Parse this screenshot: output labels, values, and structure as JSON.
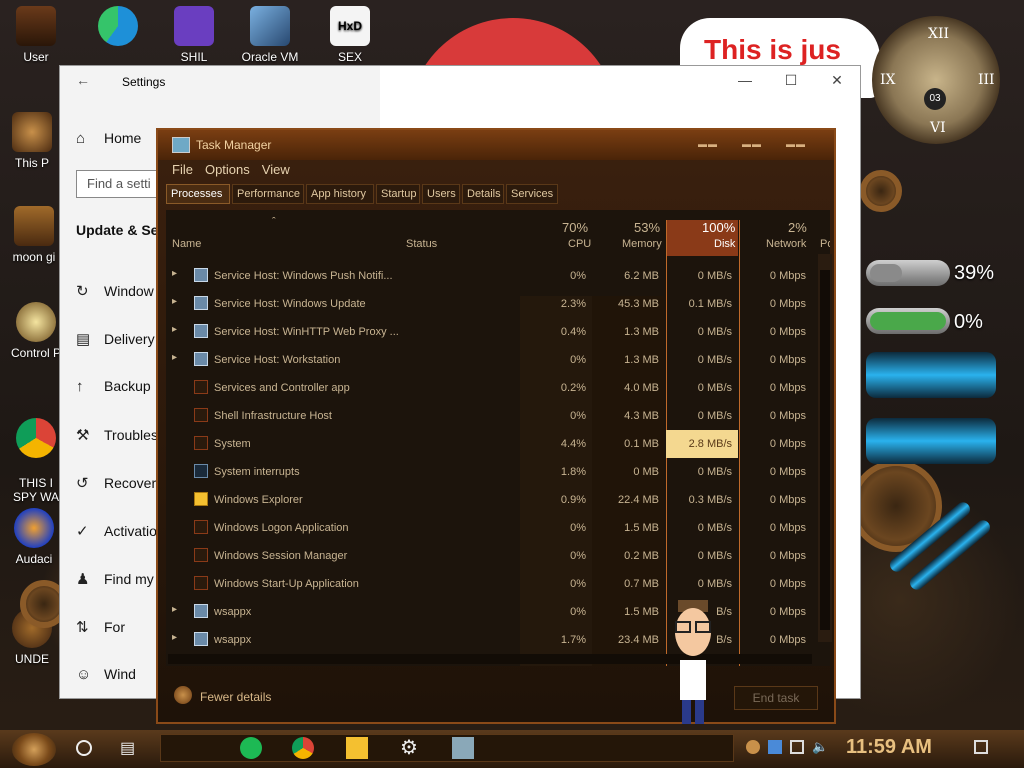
{
  "desktop": {
    "icons": [
      {
        "label": "User",
        "name": "user-folder"
      },
      {
        "label": "This P",
        "name": "this-pc"
      },
      {
        "label": "moon gi",
        "name": "moon-gi"
      },
      {
        "label": "Control P",
        "name": "control-panel"
      },
      {
        "label": "THIS I\nSPY WA",
        "name": "chrome-shortcut"
      },
      {
        "label": "Audaci",
        "name": "audacity"
      },
      {
        "label": "UNDE",
        "name": "unde"
      }
    ],
    "top_icons": [
      {
        "label": "",
        "name": "edge"
      },
      {
        "label": "SHIL",
        "name": "visual-studio"
      },
      {
        "label": "Oracle VM",
        "name": "virtualbox"
      },
      {
        "label": "SEX",
        "name": "hxd"
      }
    ],
    "bubble_text": "This is jus",
    "meters": [
      {
        "value": "39%",
        "fill": 0.39,
        "color": "#8a8a8a"
      },
      {
        "value": "0%",
        "fill": 0.0,
        "color": "#4aa84a"
      }
    ],
    "clock_badge": "03"
  },
  "settings": {
    "title": "Settings",
    "home": "Home",
    "search_placeholder": "Find a setti",
    "heading": "Update & Se",
    "items": [
      {
        "label": "Window",
        "icon": "refresh-icon"
      },
      {
        "label": "Delivery",
        "icon": "delivery-icon"
      },
      {
        "label": "Backup",
        "icon": "backup-icon"
      },
      {
        "label": "Troubles",
        "icon": "wrench-icon"
      },
      {
        "label": "Recover",
        "icon": "recovery-icon"
      },
      {
        "label": "Activatio",
        "icon": "check-circle-icon"
      },
      {
        "label": "Find my",
        "icon": "person-icon"
      },
      {
        "label": "For",
        "icon": "sliders-icon"
      },
      {
        "label": "Wind",
        "icon": "cat-icon"
      }
    ]
  },
  "taskmanager": {
    "title": "Task Manager",
    "menu": [
      "File",
      "Options",
      "View"
    ],
    "tabs": [
      "Processes",
      "Performance",
      "App history",
      "Startup",
      "Users",
      "Details",
      "Services"
    ],
    "columns": {
      "name": "Name",
      "status": "Status",
      "cpu": {
        "pct": "70%",
        "label": "CPU"
      },
      "memory": {
        "pct": "53%",
        "label": "Memory"
      },
      "disk": {
        "pct": "100%",
        "label": "Disk"
      },
      "network": {
        "pct": "2%",
        "label": "Network"
      },
      "power": "Po"
    },
    "rows": [
      {
        "name": "Service Host: Windows Push Notifi...",
        "expand": true,
        "icon": "service-icon",
        "cpu": "0%",
        "mem": "6.2 MB",
        "disk": "0 MB/s",
        "net": "0 Mbps"
      },
      {
        "name": "Service Host: Windows Update",
        "expand": true,
        "icon": "service-icon",
        "cpu": "2.3%",
        "mem": "45.3 MB",
        "disk": "0.1 MB/s",
        "net": "0 Mbps"
      },
      {
        "name": "Service Host: WinHTTP Web Proxy ...",
        "expand": true,
        "icon": "service-icon",
        "cpu": "0.4%",
        "mem": "1.3 MB",
        "disk": "0 MB/s",
        "net": "0 Mbps"
      },
      {
        "name": "Service Host: Workstation",
        "expand": true,
        "icon": "service-icon",
        "cpu": "0%",
        "mem": "1.3 MB",
        "disk": "0 MB/s",
        "net": "0 Mbps"
      },
      {
        "name": "Services and Controller app",
        "expand": false,
        "icon": "app-icon",
        "cpu": "0.2%",
        "mem": "4.0 MB",
        "disk": "0 MB/s",
        "net": "0 Mbps"
      },
      {
        "name": "Shell Infrastructure Host",
        "expand": false,
        "icon": "app-icon",
        "cpu": "0%",
        "mem": "4.3 MB",
        "disk": "0 MB/s",
        "net": "0 Mbps"
      },
      {
        "name": "System",
        "expand": false,
        "icon": "app-icon",
        "cpu": "4.4%",
        "mem": "0.1 MB",
        "disk": "2.8 MB/s",
        "net": "0 Mbps",
        "hot": true
      },
      {
        "name": "System interrupts",
        "expand": false,
        "icon": "window-icon",
        "cpu": "1.8%",
        "mem": "0 MB",
        "disk": "0 MB/s",
        "net": "0 Mbps"
      },
      {
        "name": "Windows Explorer",
        "expand": false,
        "icon": "folder-icon",
        "cpu": "0.9%",
        "mem": "22.4 MB",
        "disk": "0.3 MB/s",
        "net": "0 Mbps"
      },
      {
        "name": "Windows Logon Application",
        "expand": false,
        "icon": "app-icon",
        "cpu": "0%",
        "mem": "1.5 MB",
        "disk": "0 MB/s",
        "net": "0 Mbps"
      },
      {
        "name": "Windows Session Manager",
        "expand": false,
        "icon": "app-icon",
        "cpu": "0%",
        "mem": "0.2 MB",
        "disk": "0 MB/s",
        "net": "0 Mbps"
      },
      {
        "name": "Windows Start-Up Application",
        "expand": false,
        "icon": "app-icon",
        "cpu": "0%",
        "mem": "0.7 MB",
        "disk": "0 MB/s",
        "net": "0 Mbps"
      },
      {
        "name": "wsappx",
        "expand": true,
        "icon": "service-icon",
        "cpu": "0%",
        "mem": "1.5 MB",
        "disk": "B/s",
        "net": "0 Mbps"
      },
      {
        "name": "wsappx",
        "expand": true,
        "icon": "service-icon",
        "cpu": "1.7%",
        "mem": "23.4 MB",
        "disk": "B/s",
        "net": "0 Mbps"
      }
    ],
    "fewer_details": "Fewer details",
    "end_task": "End task"
  },
  "taskbar": {
    "time": "11:59 AM",
    "apps": [
      "spotify-icon",
      "chrome-icon",
      "file-explorer-icon",
      "settings-gear-icon",
      "task-manager-icon"
    ]
  },
  "colors": {
    "disk_hot": "#f4d890",
    "disk_header": "#8a3a18",
    "text": "#c8b492"
  }
}
